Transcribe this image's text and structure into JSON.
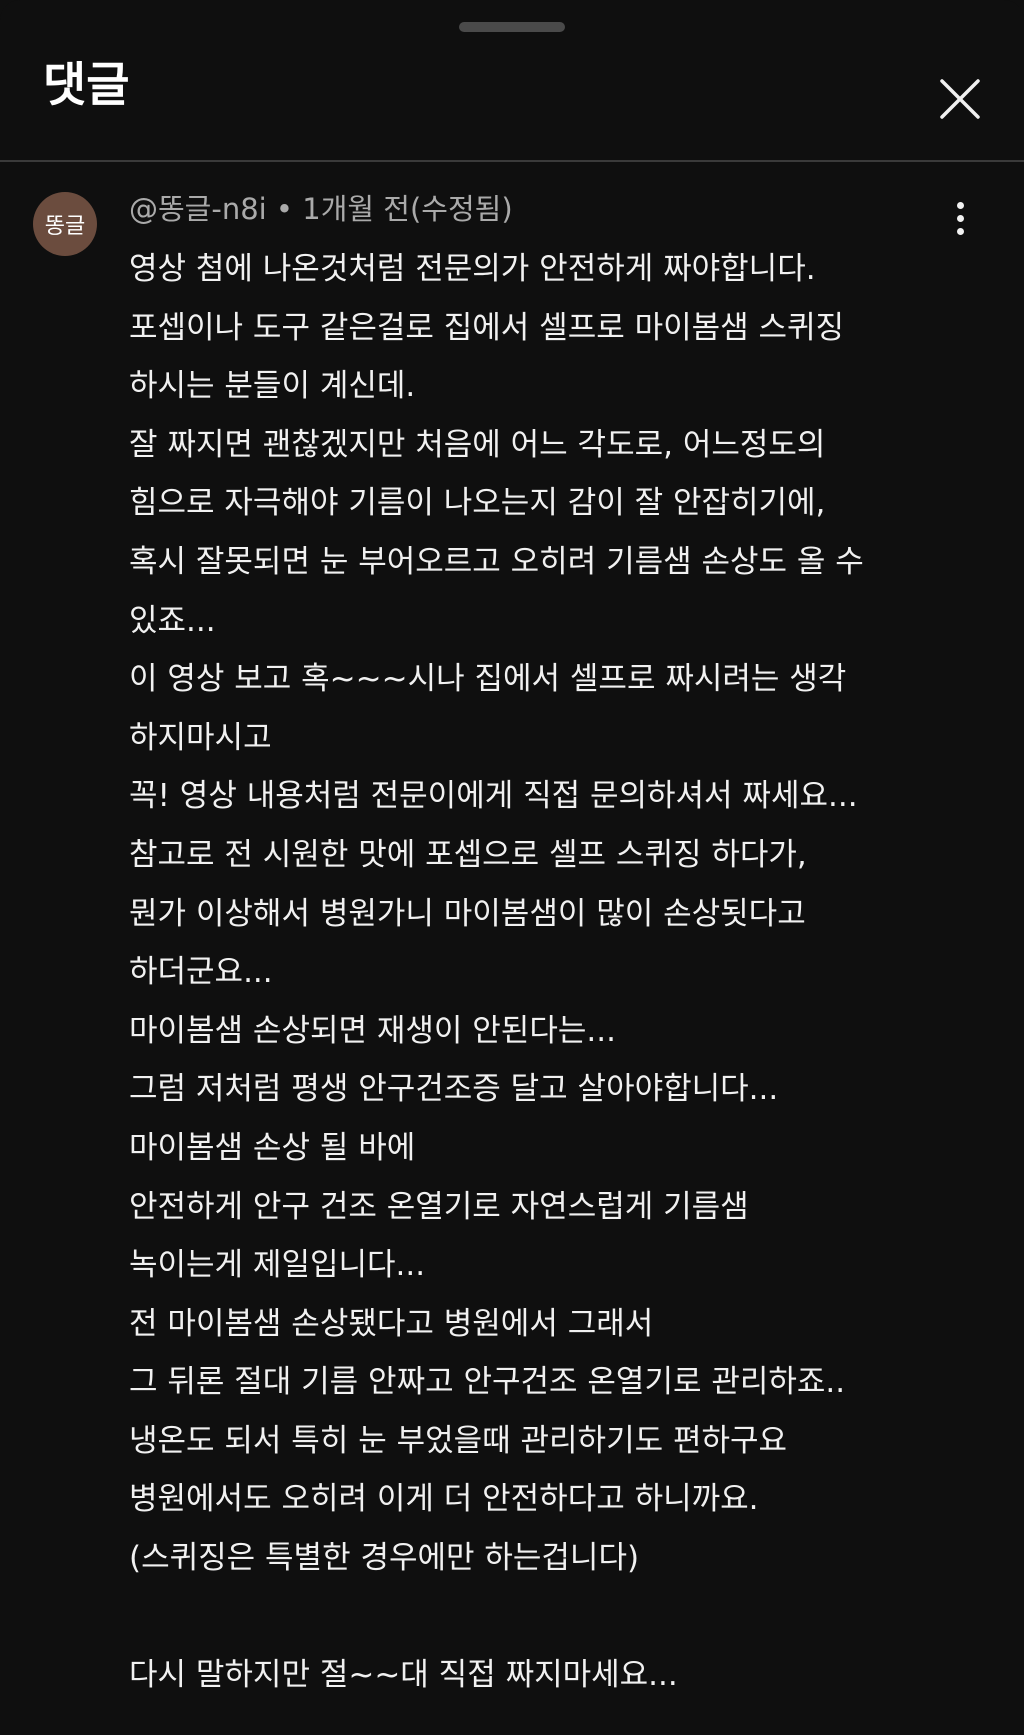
{
  "header": {
    "title": "댓글"
  },
  "comment": {
    "avatar_text": "똥글",
    "meta": "@똥글-n8i • 1개월 전(수정됨)",
    "lines": [
      "영상 첨에 나온것처럼 전문의가 안전하게 짜야합니다.",
      "포셉이나 도구 같은걸로 집에서 셀프로 마이봄샘 스퀴징",
      "하시는 분들이 계신데.",
      "잘 짜지면 괜찮겠지만 처음에 어느 각도로, 어느정도의",
      "힘으로 자극해야 기름이 나오는지 감이 잘 안잡히기에,",
      "혹시 잘못되면 눈 부어오르고 오히려 기름샘 손상도 올 수",
      "있죠...",
      "이 영상 보고 혹~~~시나 집에서 셀프로 짜시려는 생각",
      "하지마시고",
      "꼭! 영상 내용처럼 전문이에게 직접 문의하셔서 짜세요...",
      "참고로 전 시원한 맛에 포셉으로 셀프 스퀴징 하다가,",
      "뭔가 이상해서 병원가니 마이봄샘이 많이 손상됫다고",
      "하더군요...",
      "마이봄샘 손상되면 재생이 안된다는...",
      "그럼 저처럼 평생 안구건조증 달고 살아야합니다...",
      "마이봄샘 손상 될 바에",
      "안전하게 안구 건조 온열기로 자연스럽게 기름샘",
      "녹이는게 제일입니다...",
      "전 마이봄샘 손상됐다고 병원에서 그래서",
      "그 뒤론 절대 기름 안짜고 안구건조 온열기로 관리하죠..",
      "냉온도 되서 특히 눈 부었을때 관리하기도 편하구요",
      "병원에서도 오히려 이게 더 안전하다고 하니까요.",
      "(스퀴징은 특별한 경우에만 하는겁니다)",
      "",
      "다시 말하지만 절~~대 직접 짜지마세요..."
    ]
  },
  "icons": {
    "close": "close-icon",
    "more": "more-vert-icon"
  },
  "colors": {
    "background": "#0f0f0f",
    "text": "#f1f1f1",
    "meta": "#aaaaaa",
    "avatar": "#6b4c3e",
    "divider": "#3a3a3a"
  }
}
